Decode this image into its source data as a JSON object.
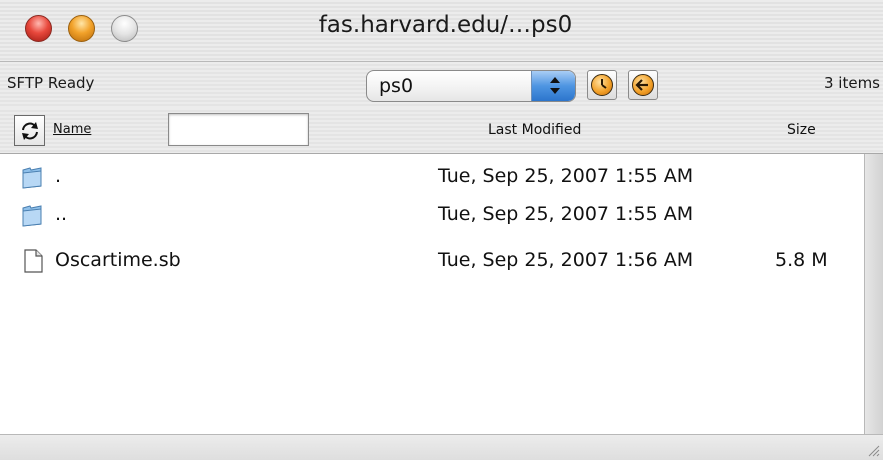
{
  "window": {
    "title": "fas.harvard.edu/…ps0"
  },
  "toolbar": {
    "status": "SFTP Ready",
    "path_selected": "ps0",
    "items_count": "3 items",
    "history_icon": "history-icon",
    "back_icon": "back-arrow-icon"
  },
  "columns": {
    "name": "Name",
    "filter_value": "",
    "last_modified": "Last Modified",
    "size": "Size"
  },
  "files": [
    {
      "icon": "folder-icon",
      "name": ".",
      "modified": "Tue, Sep 25, 2007 1:55 AM",
      "size": ""
    },
    {
      "icon": "folder-icon",
      "name": "..",
      "modified": "Tue, Sep 25, 2007 1:55 AM",
      "size": ""
    },
    {
      "icon": "document-icon",
      "name": "Oscartime.sb",
      "modified": "Tue, Sep 25, 2007 1:56 AM",
      "size": "5.8 M"
    }
  ],
  "colors": {
    "close": "#e8483c",
    "minimize": "#f2a22a",
    "popup_accent": "#4e95e2",
    "folder": "#8fc0ea"
  }
}
